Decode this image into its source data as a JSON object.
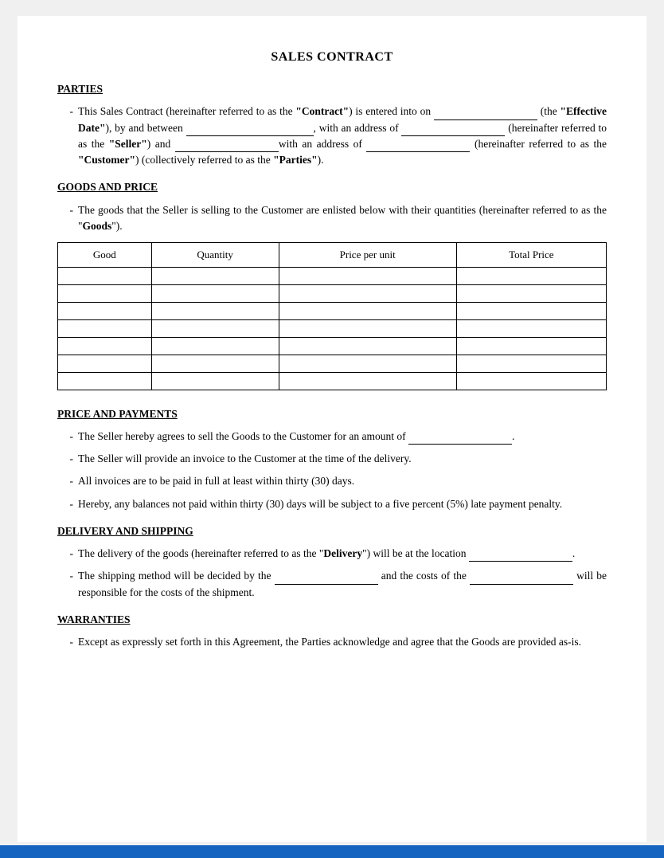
{
  "document": {
    "title": "SALES CONTRACT",
    "sections": {
      "parties": {
        "heading": "PARTIES",
        "paragraph": "This Sales Contract (hereinafter referred to as the “Contract”) is entered into on ________________ (the “Effective Date”), by and between _______________________,  with an address of ________________ (hereinafter referred to as the “Seller”) and ________________with an address of ________________ (hereinafter referred to as the “Customer”) (collectively referred to as the “Parties”)."
      },
      "goods_and_price": {
        "heading": "GOODS AND PRICE",
        "paragraph": "The goods that the Seller is selling to the Customer are enlisted below with their quantities (hereinafter referred to as the “Goods”).",
        "table": {
          "headers": [
            "Good",
            "Quantity",
            "Price per unit",
            "Total Price"
          ],
          "rows": 7
        }
      },
      "price_and_payments": {
        "heading": "PRICE AND PAYMENTS",
        "items": [
          "The Seller hereby agrees to sell the Goods to the Customer for an amount of ________________.",
          "The Seller will provide an invoice to the Customer at the time of the delivery.",
          "All invoices are to be paid in full at least within thirty (30) days.",
          "Hereby, any balances not paid within thirty (30) days will be subject to a five percent (5%) late payment penalty."
        ]
      },
      "delivery_and_shipping": {
        "heading": "DELIVERY AND SHIPPING",
        "items": [
          "The delivery of the goods (hereinafter referred to as the “Delivery”) will be at the location ________________.",
          "The shipping method will be decided by the ________________ and the costs of the ________________ will be responsible for the costs of the shipment."
        ]
      },
      "warranties": {
        "heading": "WARRANTIES",
        "items": [
          "Except as expressly set forth in this Agreement, the Parties acknowledge and agree that the Goods are provided as-is."
        ]
      }
    }
  }
}
